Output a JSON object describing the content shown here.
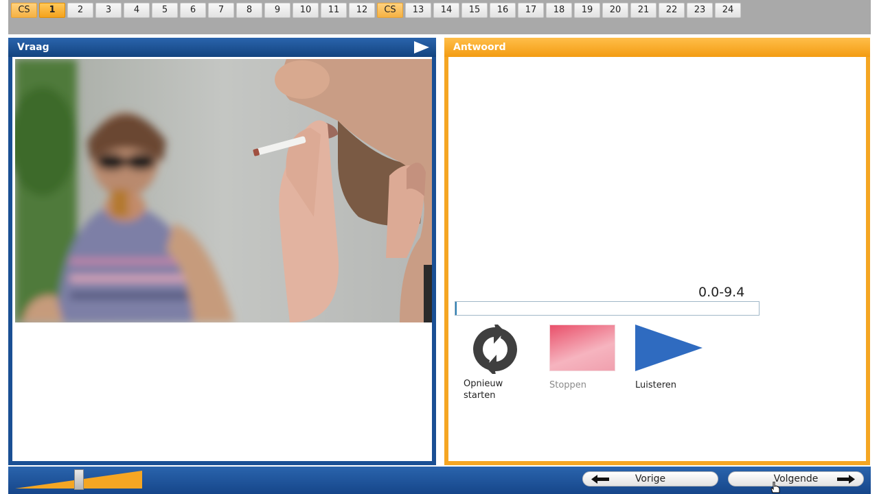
{
  "nav": {
    "items": [
      {
        "label": "CS",
        "kind": "cs"
      },
      {
        "label": "1",
        "kind": "current"
      },
      {
        "label": "2",
        "kind": "num"
      },
      {
        "label": "3",
        "kind": "num"
      },
      {
        "label": "4",
        "kind": "num"
      },
      {
        "label": "5",
        "kind": "num"
      },
      {
        "label": "6",
        "kind": "num"
      },
      {
        "label": "7",
        "kind": "num"
      },
      {
        "label": "8",
        "kind": "num"
      },
      {
        "label": "9",
        "kind": "num"
      },
      {
        "label": "10",
        "kind": "num"
      },
      {
        "label": "11",
        "kind": "num"
      },
      {
        "label": "12",
        "kind": "num"
      },
      {
        "label": "CS",
        "kind": "cs"
      },
      {
        "label": "13",
        "kind": "num"
      },
      {
        "label": "14",
        "kind": "num"
      },
      {
        "label": "15",
        "kind": "num"
      },
      {
        "label": "16",
        "kind": "num"
      },
      {
        "label": "17",
        "kind": "num"
      },
      {
        "label": "18",
        "kind": "num"
      },
      {
        "label": "19",
        "kind": "num"
      },
      {
        "label": "20",
        "kind": "num"
      },
      {
        "label": "21",
        "kind": "num"
      },
      {
        "label": "22",
        "kind": "num"
      },
      {
        "label": "23",
        "kind": "num"
      },
      {
        "label": "24",
        "kind": "num"
      }
    ]
  },
  "question": {
    "title": "Vraag",
    "image_icon": "photo"
  },
  "answer": {
    "title": "Antwoord",
    "time_range": "0.0-9.4",
    "progress_fraction": 0.0,
    "controls": {
      "restart_label": "Opnieuw starten",
      "stop_label": "Stoppen",
      "listen_label": "Luisteren"
    }
  },
  "footer": {
    "volume_level": 0.5,
    "prev_label": "Vorige",
    "next_label": "Volgende"
  },
  "colors": {
    "blue": "#1a4f94",
    "orange": "#f5a623",
    "current_tab": "#f5a21c"
  }
}
